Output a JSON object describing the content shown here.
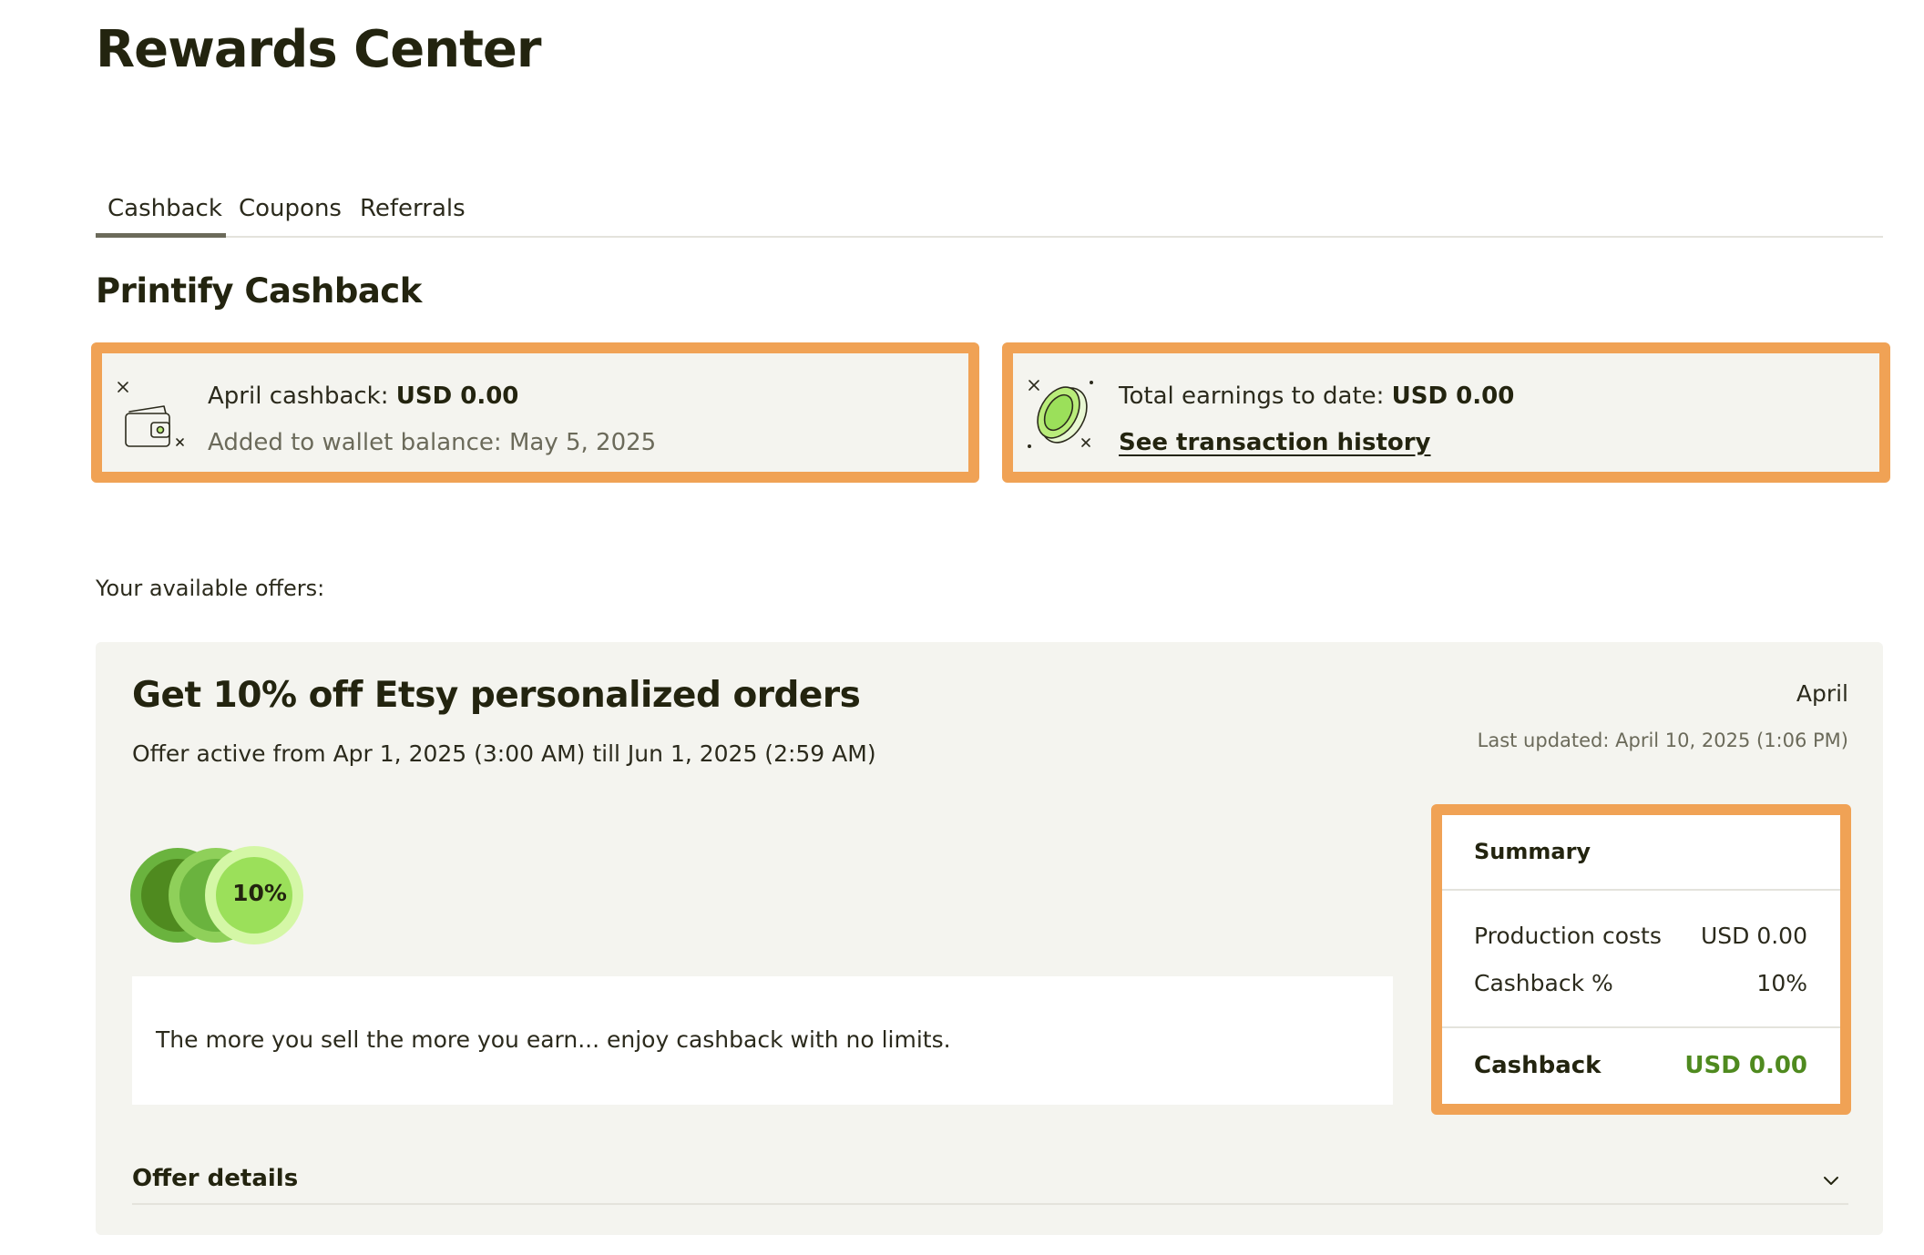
{
  "page": {
    "title": "Rewards Center"
  },
  "tabs": [
    {
      "label": "Cashback",
      "active": true
    },
    {
      "label": "Coupons",
      "active": false
    },
    {
      "label": "Referrals",
      "active": false
    }
  ],
  "section_title": "Printify Cashback",
  "cashback_card": {
    "label": "April cashback:",
    "amount": "USD 0.00",
    "note": "Added to wallet balance: May 5, 2025",
    "icon": "wallet-icon"
  },
  "earnings_card": {
    "label": "Total earnings to date:",
    "amount": "USD 0.00",
    "link": "See transaction history",
    "icon": "coin-icon"
  },
  "available_offers_label": "Your available offers:",
  "offer": {
    "title": "Get 10% off Etsy personalized orders",
    "dates": "Offer active from Apr 1, 2025 (3:00 AM) till Jun 1, 2025 (2:59 AM)",
    "month": "April",
    "last_updated": "Last updated: April 10, 2025 (1:06 PM)",
    "badge": "10%",
    "description": "The more you sell the more you earn... enjoy cashback with no limits.",
    "details_label": "Offer details"
  },
  "summary": {
    "title": "Summary",
    "rows": [
      {
        "label": "Production costs",
        "value": "USD 0.00"
      },
      {
        "label": "Cashback %",
        "value": "10%"
      }
    ],
    "total_label": "Cashback",
    "total_value": "USD 0.00"
  },
  "colors": {
    "highlight_border": "#f0a255",
    "card_bg": "#f4f4ef",
    "accent_green": "#4f8a1f",
    "text_dark": "#23240f"
  }
}
